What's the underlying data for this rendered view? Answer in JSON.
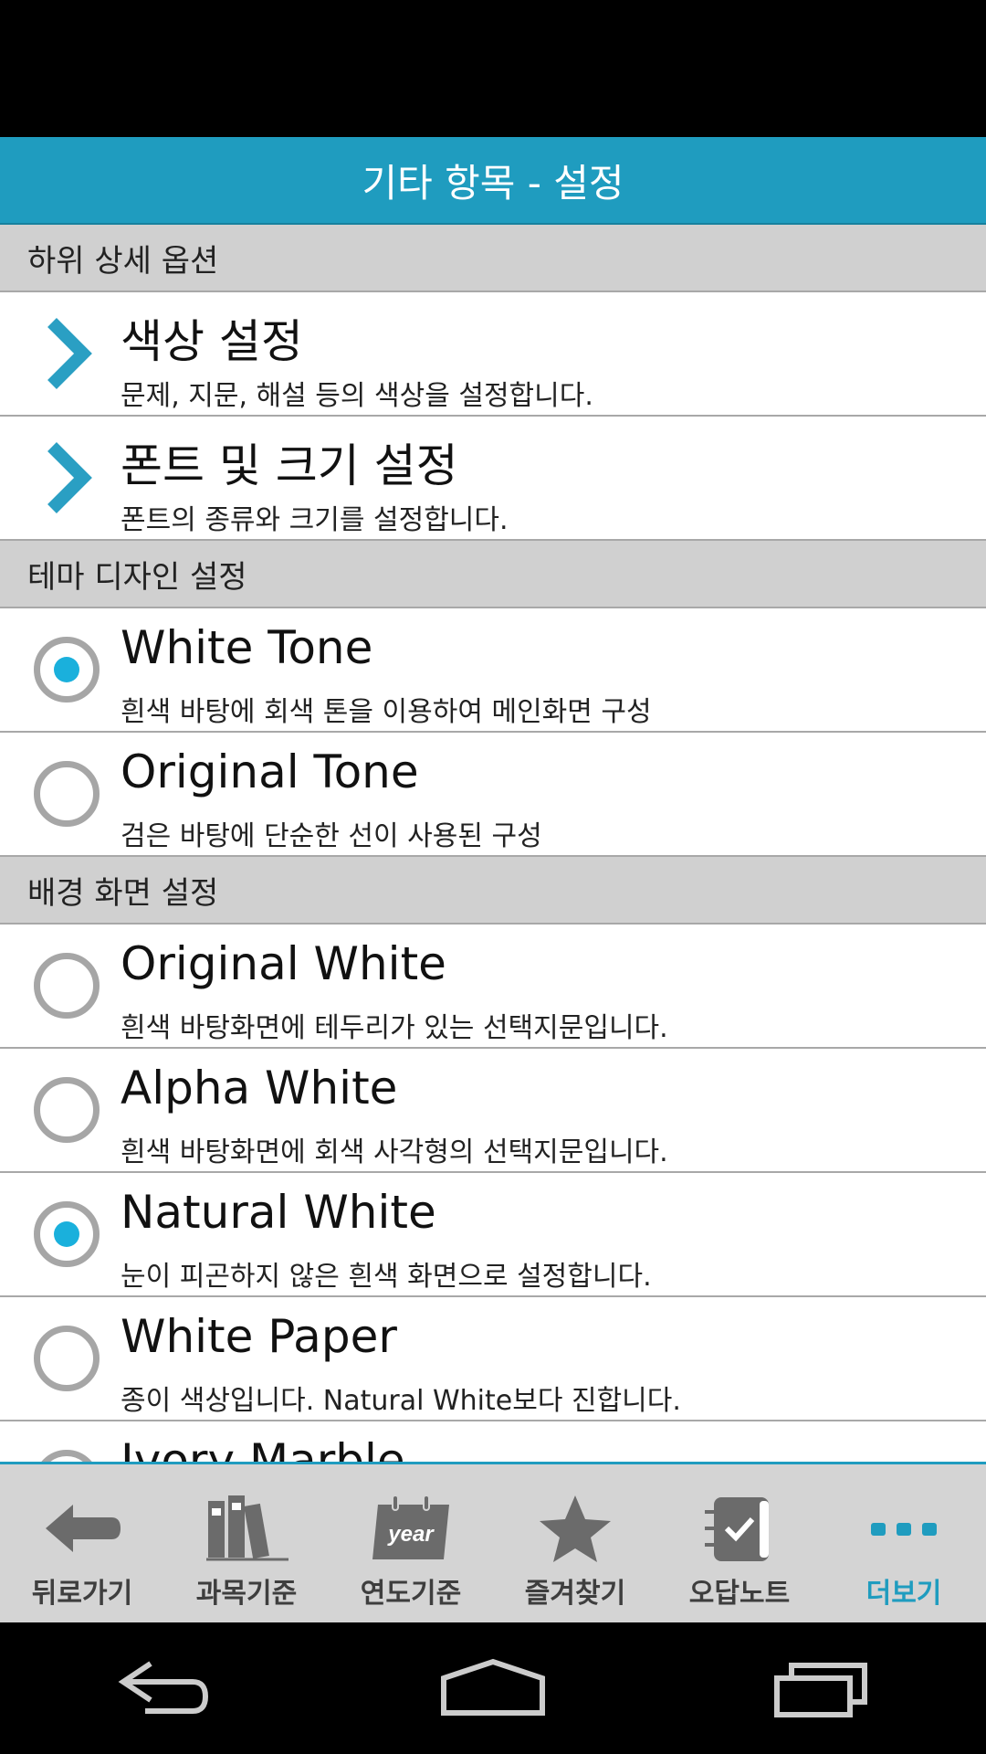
{
  "header": {
    "title": "기타 항목 - 설정"
  },
  "sections": {
    "sub_options": {
      "label": "하위 상세 옵션",
      "items": [
        {
          "title": "색상 설정",
          "desc": "문제, 지문, 해설 등의 색상을 설정합니다."
        },
        {
          "title": "폰트 및 크기 설정",
          "desc": "폰트의 종류와 크기를 설정합니다."
        }
      ]
    },
    "theme": {
      "label": "테마 디자인 설정",
      "items": [
        {
          "title": "White Tone",
          "desc": "흰색 바탕에 회색 톤을 이용하여 메인화면 구성",
          "selected": true
        },
        {
          "title": "Original Tone",
          "desc": "검은 바탕에 단순한 선이 사용된 구성",
          "selected": false
        }
      ]
    },
    "background": {
      "label": "배경 화면 설정",
      "items": [
        {
          "title": "Original White",
          "desc": "흰색 바탕화면에 테두리가 있는 선택지문입니다.",
          "selected": false
        },
        {
          "title": "Alpha White",
          "desc": "흰색 바탕화면에 회색 사각형의 선택지문입니다.",
          "selected": false
        },
        {
          "title": "Natural White",
          "desc": "눈이 피곤하지 않은 흰색 화면으로 설정합니다.",
          "selected": true
        },
        {
          "title": "White Paper",
          "desc": "종이 색상입니다. Natural White보다 진합니다.",
          "selected": false
        },
        {
          "title": "Ivory Marble",
          "desc": "",
          "selected": false
        }
      ]
    }
  },
  "bottom_nav": {
    "items": [
      {
        "label": "뒤로가기",
        "icon": "back-arrow-icon"
      },
      {
        "label": "과목기준",
        "icon": "books-icon"
      },
      {
        "label": "연도기준",
        "icon": "calendar-year-icon",
        "icon_text": "year"
      },
      {
        "label": "즐겨찾기",
        "icon": "star-icon"
      },
      {
        "label": "오답노트",
        "icon": "notebook-check-icon"
      },
      {
        "label": "더보기",
        "icon": "more-dots-icon",
        "active": true
      }
    ]
  },
  "colors": {
    "accent": "#1f9cbf",
    "radio_selected": "#1ab0dc",
    "section_bg": "#d0d0d0",
    "nav_bg": "#d4d4d4"
  }
}
